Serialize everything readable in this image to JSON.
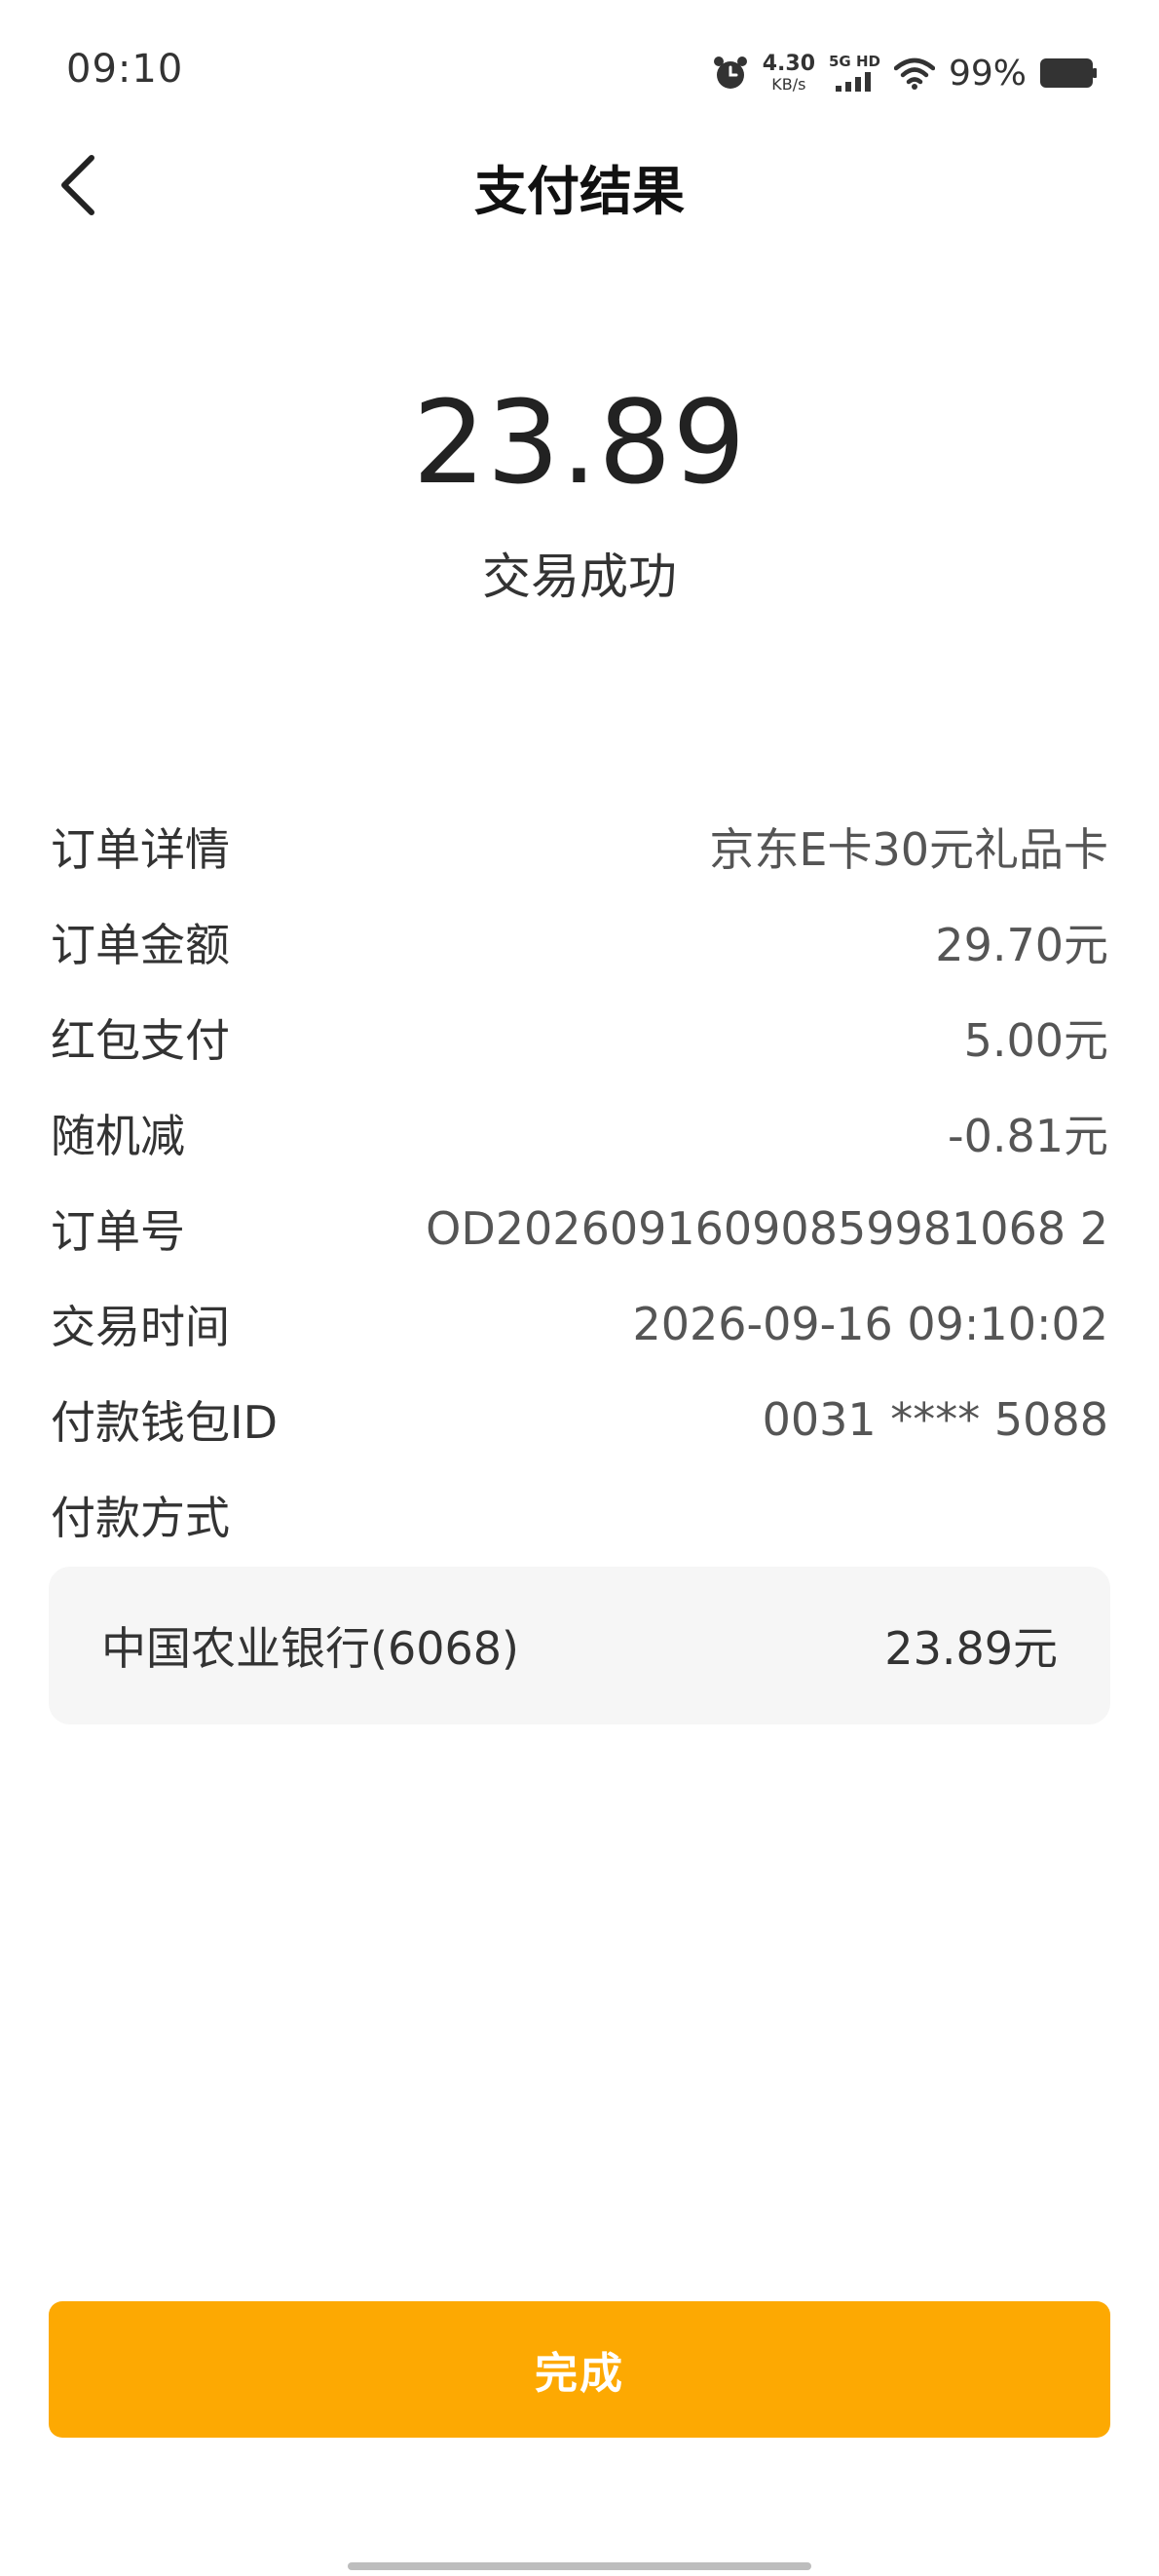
{
  "status_bar": {
    "time": "09:10",
    "net_speed_value": "4.30",
    "net_speed_unit": "KB/s",
    "network_label": "5G HD",
    "battery": "99%",
    "icons": [
      "alarm-icon",
      "signal-icon",
      "wifi-icon",
      "battery-icon"
    ]
  },
  "header": {
    "title": "支付结果",
    "back_icon": "chevron-left-icon"
  },
  "summary": {
    "amount": "23.89",
    "status": "交易成功"
  },
  "details": [
    {
      "label": "订单详情",
      "value": "京东E卡30元礼品卡"
    },
    {
      "label": "订单金额",
      "value": "29.70元"
    },
    {
      "label": "红包支付",
      "value": "5.00元"
    },
    {
      "label": "随机减",
      "value": "-0.81元"
    },
    {
      "label": "订单号",
      "value": "OD20260916090859981068 2"
    },
    {
      "label": "交易时间",
      "value": "2026-09-16 09:10:02"
    },
    {
      "label": "付款钱包ID",
      "value": "0031 **** 5088"
    },
    {
      "label": "付款方式",
      "value": ""
    }
  ],
  "payment_method": {
    "name": "中国农业银行(6068)",
    "amount": "23.89元"
  },
  "actions": {
    "done_label": "完成"
  },
  "colors": {
    "accent": "#fda902",
    "card_bg": "#f6f6f6",
    "text_primary": "#222222",
    "text_secondary": "#555555"
  }
}
